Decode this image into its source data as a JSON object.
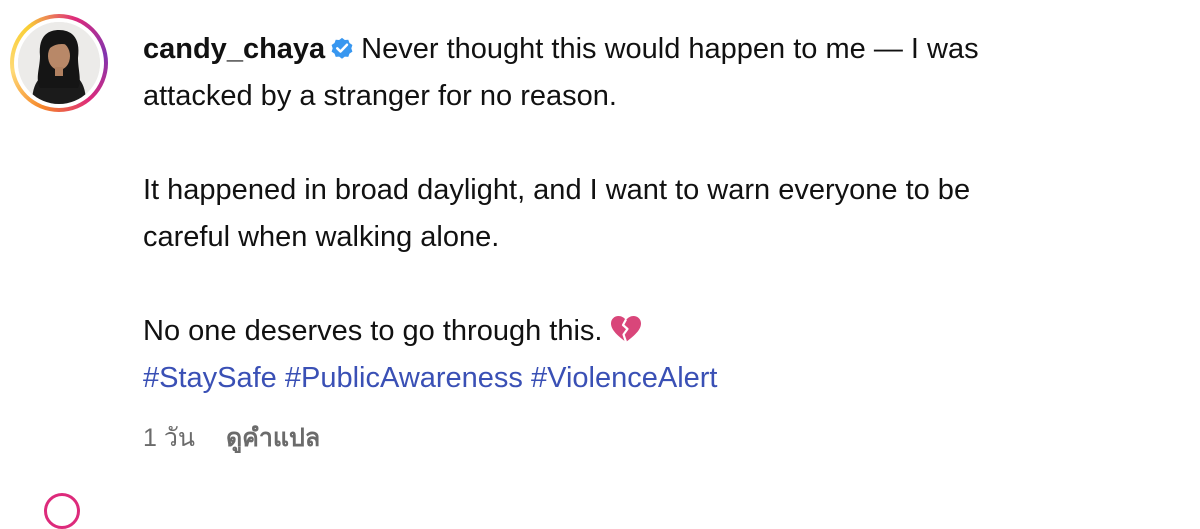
{
  "post": {
    "username": "candy_chaya",
    "verified_icon": "verified-badge-icon",
    "accent_color": "#3897f0",
    "caption_line_1": "Never thought this would happen to me — I was",
    "caption_line_2": "attacked by a stranger for no reason.",
    "caption_line_3": "It happened in broad daylight, and I want to warn everyone to be",
    "caption_line_4": "careful when walking alone.",
    "caption_line_5": "No one deserves to go through this.",
    "emoji_icon": "broken-heart-icon",
    "hashtags": [
      "#StaySafe",
      "#PublicAwareness",
      "#ViolenceAlert"
    ],
    "hashtag_color": "#3a50b5",
    "time_ago": "1 วัน",
    "translate_label": "ดูคำแปล"
  }
}
